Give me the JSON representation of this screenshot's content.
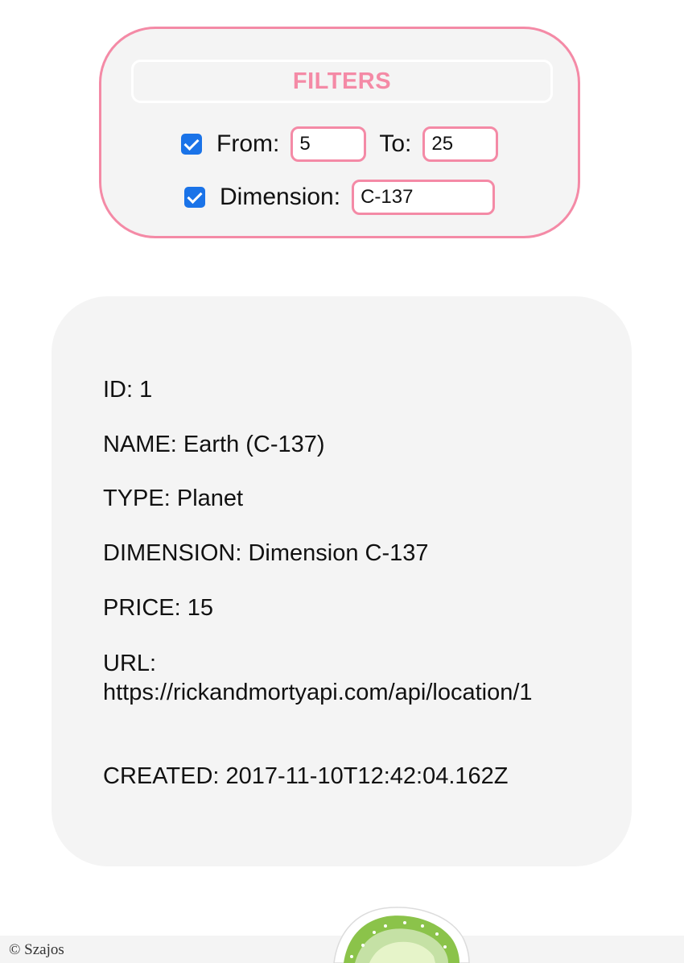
{
  "filters": {
    "title": "FILTERS",
    "from_label": "From:",
    "from_value": "5",
    "from_checked": true,
    "to_label": "To:",
    "to_value": "25",
    "dimension_label": "Dimension:",
    "dimension_value": "C-137",
    "dimension_checked": true
  },
  "location": {
    "id_line": "ID: 1",
    "name_line": "NAME: Earth (C-137)",
    "type_line": "TYPE: Planet",
    "dimension_line": "DIMENSION: Dimension C-137",
    "price_line": "PRICE: 15",
    "url_label": "URL:",
    "url_value": "https://rickandmortyapi.com/api/location/1",
    "created_line": "CREATED: 2017-11-10T12:42:04.162Z"
  },
  "footer": {
    "copyright": "© Szajos"
  },
  "images": {
    "portal": "green-portal-icon"
  },
  "colors": {
    "accent": "#f48aa6",
    "panel_bg": "#f4f4f4",
    "checkbox": "#1a73e8",
    "portal_green": "#8bc34a"
  }
}
